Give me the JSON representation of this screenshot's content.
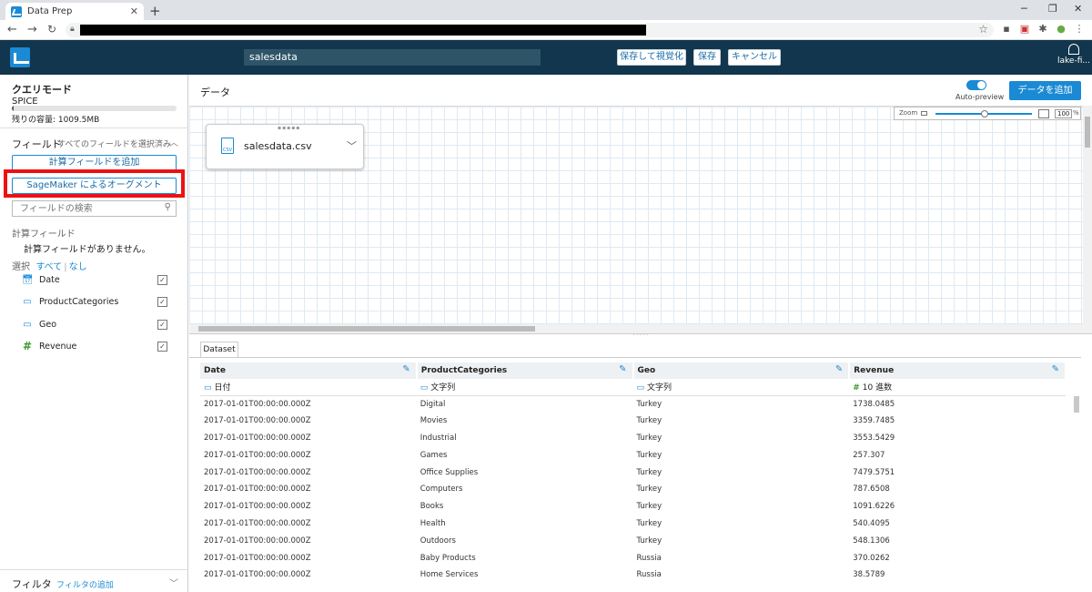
{
  "browser": {
    "tab_title": "Data Prep",
    "tab_close": "✕",
    "new_tab": "+"
  },
  "header": {
    "dataset_name": "salesdata",
    "save_visualize": "保存して視覚化",
    "save": "保存",
    "cancel": "キャンセル",
    "user": "lake-fi..."
  },
  "left_panel": {
    "query_mode": "クエリモード",
    "spice": "SPICE",
    "spice_fill_fraction": 0.01,
    "remaining": "残りの容量: 1009.5MB",
    "fields_title": "フィールド",
    "fields_status": "すべてのフィールドを選択済み",
    "add_calc_field": "計算フィールドを追加",
    "sagemaker_augment": "SageMaker によるオーグメント",
    "search_placeholder": "フィールドの検索",
    "calc_fields_label": "計算フィールド",
    "no_calc_fields": "計算フィールドがありません。",
    "select_label": "選択",
    "select_all": "すべて",
    "select_none": "なし",
    "fields": [
      {
        "name": "Date",
        "icon": "calendar-icon",
        "checked": true
      },
      {
        "name": "ProductCategories",
        "icon": "string-icon",
        "checked": true
      },
      {
        "name": "Geo",
        "icon": "string-icon",
        "checked": true
      },
      {
        "name": "Revenue",
        "icon": "number-icon",
        "checked": true
      }
    ],
    "filter_title": "フィルタ",
    "filter_add": "フィルタの追加"
  },
  "main": {
    "title": "データ",
    "auto_preview": "Auto-preview",
    "add_data": "データを追加",
    "zoom_label": "Zoom",
    "zoom_value": "100",
    "zoom_unit": "%",
    "file_name": "salesdata.csv",
    "file_icon_text": "CSV",
    "dataset_tab": "Dataset"
  },
  "table": {
    "columns": [
      {
        "name": "Date",
        "type": "日付",
        "type_icon": "▭"
      },
      {
        "name": "ProductCategories",
        "type": "文字列",
        "type_icon": "▭"
      },
      {
        "name": "Geo",
        "type": "文字列",
        "type_icon": "▭"
      },
      {
        "name": "Revenue",
        "type": "10 進数",
        "type_icon": "#"
      }
    ],
    "rows": [
      [
        "2017-01-01T00:00:00.000Z",
        "Digital",
        "Turkey",
        "1738.0485"
      ],
      [
        "2017-01-01T00:00:00.000Z",
        "Movies",
        "Turkey",
        "3359.7485"
      ],
      [
        "2017-01-01T00:00:00.000Z",
        "Industrial",
        "Turkey",
        "3553.5429"
      ],
      [
        "2017-01-01T00:00:00.000Z",
        "Games",
        "Turkey",
        "257.307"
      ],
      [
        "2017-01-01T00:00:00.000Z",
        "Office Supplies",
        "Turkey",
        "7479.5751"
      ],
      [
        "2017-01-01T00:00:00.000Z",
        "Computers",
        "Turkey",
        "787.6508"
      ],
      [
        "2017-01-01T00:00:00.000Z",
        "Books",
        "Turkey",
        "1091.6226"
      ],
      [
        "2017-01-01T00:00:00.000Z",
        "Health",
        "Turkey",
        "540.4095"
      ],
      [
        "2017-01-01T00:00:00.000Z",
        "Outdoors",
        "Turkey",
        "548.1306"
      ],
      [
        "2017-01-01T00:00:00.000Z",
        "Baby Products",
        "Russia",
        "370.0262"
      ],
      [
        "2017-01-01T00:00:00.000Z",
        "Home Services",
        "Russia",
        "38.5789"
      ]
    ]
  },
  "colors": {
    "header_bg": "#11364d",
    "accent": "#1a8ad4",
    "highlight": "#ee1111"
  }
}
